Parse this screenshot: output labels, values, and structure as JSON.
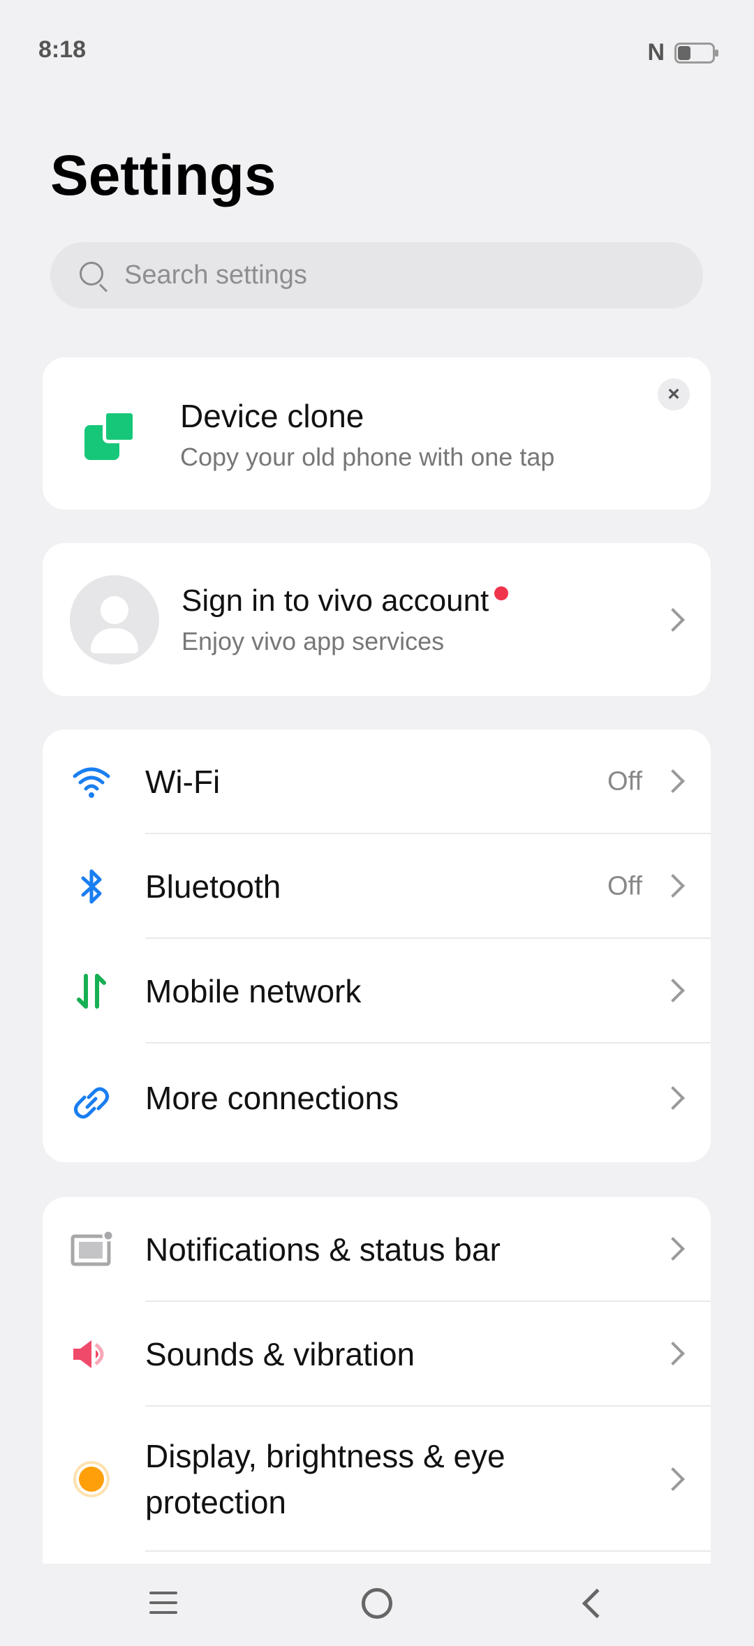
{
  "status": {
    "time": "8:18",
    "nfc": "N"
  },
  "title": "Settings",
  "search": {
    "placeholder": "Search settings"
  },
  "clone_card": {
    "title": "Device clone",
    "subtitle": "Copy your old phone with one tap",
    "close": "×"
  },
  "account_card": {
    "title": "Sign in to vivo account",
    "subtitle": "Enjoy vivo app services"
  },
  "connections": [
    {
      "label": "Wi-Fi",
      "value": "Off",
      "icon": "wifi-icon"
    },
    {
      "label": "Bluetooth",
      "value": "Off",
      "icon": "bluetooth-icon"
    },
    {
      "label": "Mobile network",
      "value": "",
      "icon": "mobile-network-icon"
    },
    {
      "label": "More connections",
      "value": "",
      "icon": "link-icon"
    }
  ],
  "device": [
    {
      "label": "Notifications & status bar",
      "icon": "notification-icon"
    },
    {
      "label": "Sounds & vibration",
      "icon": "speaker-icon"
    },
    {
      "label": "Display, brightness & eye protection",
      "icon": "brightness-icon"
    }
  ],
  "colors": {
    "accent_blue": "#1a7ef0",
    "green": "#16c77a",
    "red_dot": "#f0344b",
    "orange": "#ff9f0a",
    "pink": "#f04a6a"
  }
}
